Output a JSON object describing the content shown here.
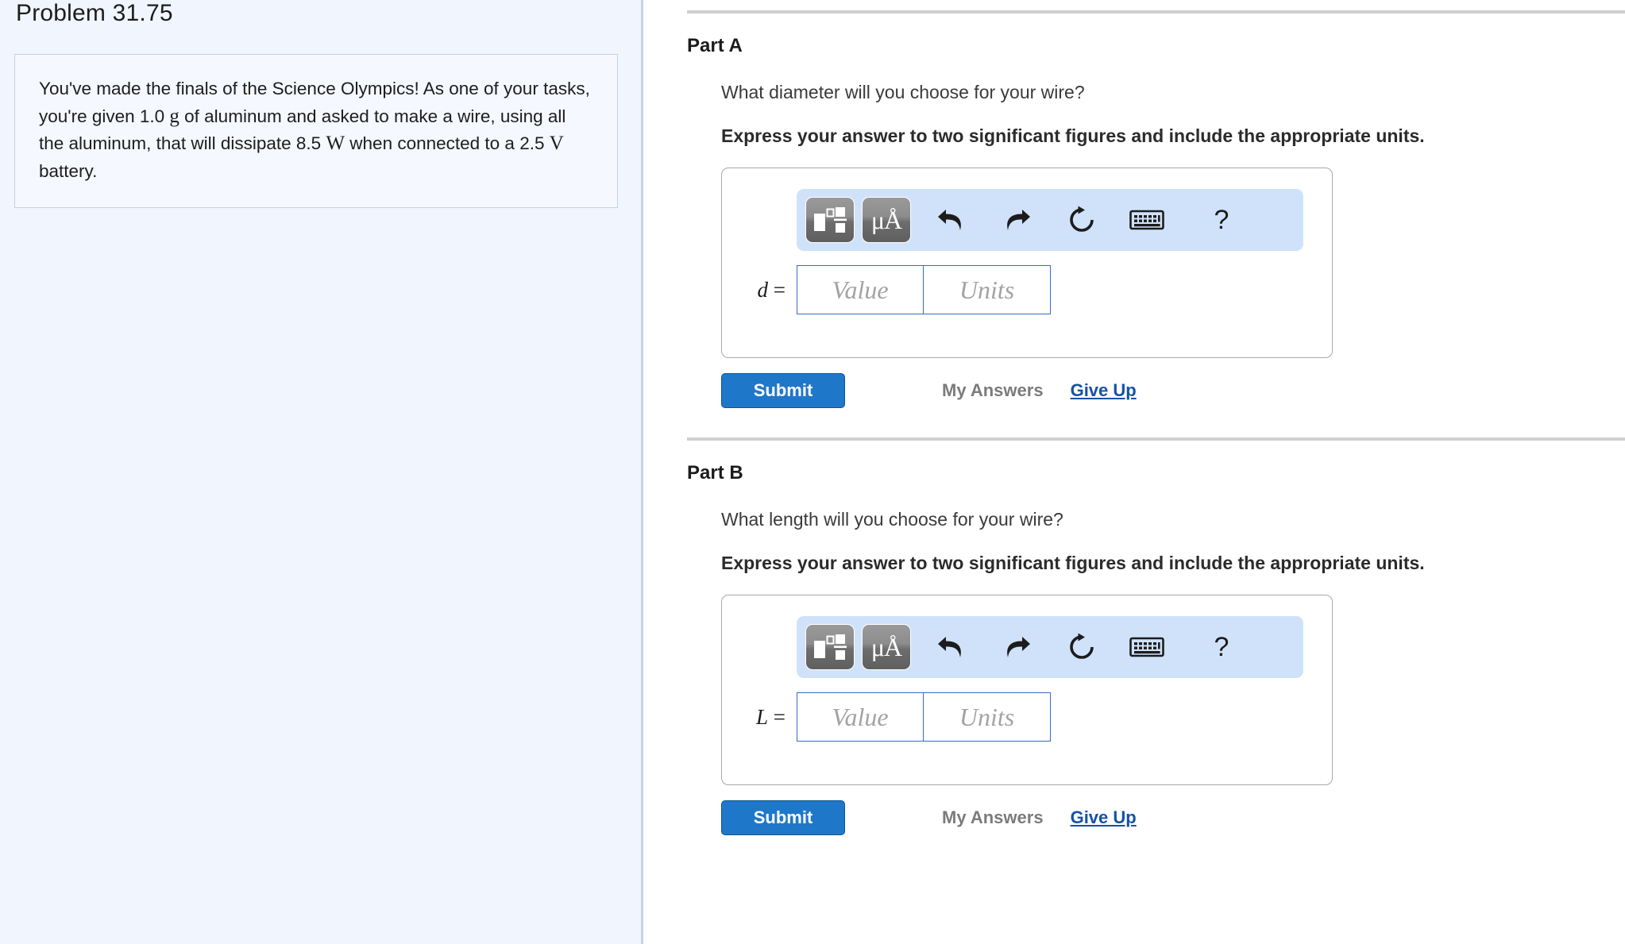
{
  "problem": {
    "title": "Problem 31.75",
    "statement_segments": [
      {
        "type": "text",
        "text": "You've made the finals of the Science Olympics! As one of your tasks, you're given 1.0 "
      },
      {
        "type": "math",
        "text": "g"
      },
      {
        "type": "text",
        "text": " of aluminum and asked to make a wire, using all the aluminum, that will dissipate 8.5 "
      },
      {
        "type": "math",
        "text": "W"
      },
      {
        "type": "text",
        "text": " when connected to a 2.5 "
      },
      {
        "type": "math",
        "text": "V"
      },
      {
        "type": "text",
        "text": " battery."
      }
    ],
    "statement_plain": "You've made the finals of the Science Olympics! As one of your tasks, you're given 1.0 g of aluminum and asked to make a wire, using all the aluminum, that will dissipate 8.5 W when connected to a 2.5 V battery."
  },
  "parts": {
    "a": {
      "heading": "Part A",
      "question": "What diameter will you choose for your wire?",
      "instruction": "Express your answer to two significant figures and include the appropriate units.",
      "variable": "d",
      "equals": "=",
      "value_placeholder": "Value",
      "units_placeholder": "Units",
      "value": "",
      "units": "",
      "toolbar": {
        "templates_label": "math-templates",
        "units_label": "μÅ",
        "undo_label": "undo",
        "redo_label": "redo",
        "reset_label": "reset",
        "keyboard_label": "keyboard",
        "help_label": "?"
      },
      "submit_label": "Submit",
      "my_answers_label": "My Answers",
      "give_up_label": "Give Up"
    },
    "b": {
      "heading": "Part B",
      "question": "What length will you choose for your wire?",
      "instruction": "Express your answer to two significant figures and include the appropriate units.",
      "variable": "L",
      "equals": "=",
      "value_placeholder": "Value",
      "units_placeholder": "Units",
      "value": "",
      "units": "",
      "toolbar": {
        "templates_label": "math-templates",
        "units_label": "μÅ",
        "undo_label": "undo",
        "redo_label": "redo",
        "reset_label": "reset",
        "keyboard_label": "keyboard",
        "help_label": "?"
      },
      "submit_label": "Submit",
      "my_answers_label": "My Answers",
      "give_up_label": "Give Up"
    }
  },
  "colors": {
    "left_panel_bg": "#f1f5fd",
    "statement_border": "#c1d2e4",
    "toolbar_bg": "#cfe2fa",
    "submit_blue": "#1f77c9",
    "link_blue": "#1352a8",
    "field_border": "#3b69c4",
    "rule_gray": "#d0d0d0"
  }
}
